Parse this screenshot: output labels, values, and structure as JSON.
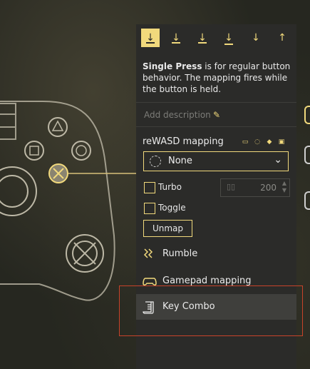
{
  "mode_bar": {
    "modes": [
      {
        "name": "single-press",
        "glyph": "↓",
        "active": true
      },
      {
        "name": "long-press",
        "glyph": "↓",
        "active": false
      },
      {
        "name": "double-press",
        "glyph": "↓",
        "active": false
      },
      {
        "name": "triple-press",
        "glyph": "↓",
        "active": false
      },
      {
        "name": "start-press",
        "glyph": "↓",
        "active": false
      },
      {
        "name": "release",
        "glyph": "↑",
        "active": false
      }
    ]
  },
  "description": {
    "mode_name": "Single Press",
    "text": " is for regular button behavior. The mapping fires while the button is held."
  },
  "add_description": {
    "placeholder": "Add description"
  },
  "mapping": {
    "title": "reWASD mapping",
    "device_icons": [
      "keyboard-icon",
      "mouse-icon",
      "playstation-icon",
      "terminal-icon"
    ],
    "selected": "None"
  },
  "turbo": {
    "label": "Turbo",
    "checked": false,
    "value": "200"
  },
  "toggle": {
    "label": "Toggle",
    "checked": false
  },
  "unmap_label": "Unmap",
  "menu": {
    "rumble": "Rumble",
    "gamepad_mapping": "Gamepad mapping",
    "key_combo": "Key Combo"
  },
  "colors": {
    "accent": "#f1d97c",
    "panel": "#2b2b29",
    "highlight": "#3f3f3c",
    "focus_outline": "#c8432a"
  }
}
